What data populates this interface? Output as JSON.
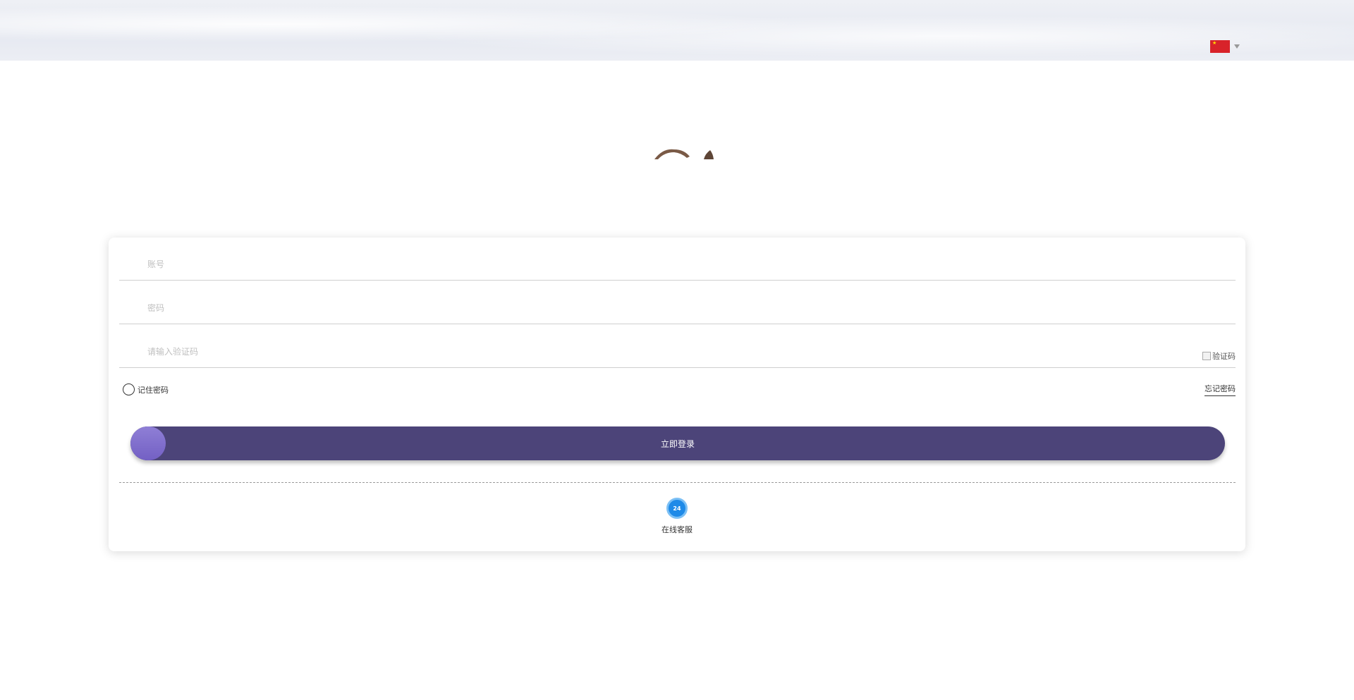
{
  "language": {
    "flag_icon": "china-flag-icon",
    "dropdown_icon": "caret-down-icon"
  },
  "logo": {
    "icon": "brand-logo-icon",
    "colors": [
      "#7a5a46",
      "#5e4536"
    ]
  },
  "form": {
    "username_placeholder": "账号",
    "password_placeholder": "密码",
    "captcha_placeholder": "请输入验证码",
    "captcha_alt": "验证码",
    "remember_label": "记住密码",
    "forgot_label": "忘记密码"
  },
  "login": {
    "button_label": "立即登录",
    "color": "#4c4479",
    "knob_color": "#7a68cc"
  },
  "support": {
    "icon": "support-24h-icon",
    "icon_text": "24",
    "label": "在线客服",
    "color": "#1e8ae8"
  }
}
